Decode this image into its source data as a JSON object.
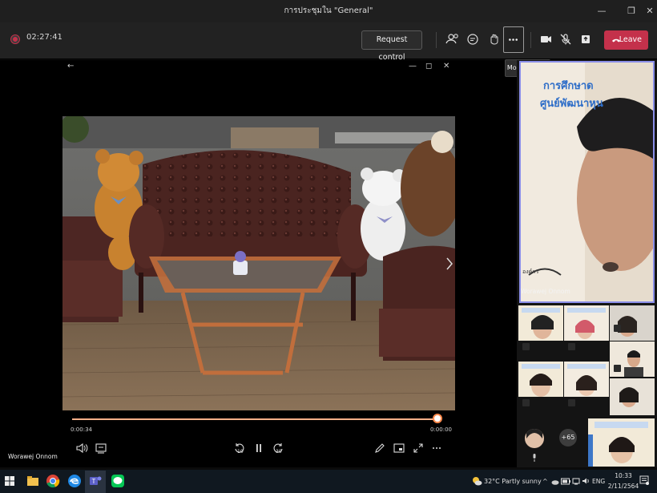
{
  "window": {
    "title": "การประชุมใน \"General\"",
    "minimize_glyph": "—",
    "maximize_glyph": "❐",
    "close_glyph": "✕"
  },
  "toolbar": {
    "timer": "02:27:41",
    "request_control_label": "Request control",
    "leave_label": "Leave",
    "more_actions_tooltip": "More actions",
    "icons": [
      "participants-icon",
      "chat-icon",
      "react-icon",
      "more-icon",
      "camera-icon",
      "mic-muted-icon",
      "share-icon"
    ]
  },
  "popout": {
    "back_glyph": "←",
    "minimize_glyph": "—",
    "maximize_glyph": "◻",
    "close_glyph": "✕"
  },
  "player": {
    "elapsed": "0:00:34",
    "remaining": "0:00:00",
    "progress": 1.0,
    "skip_back_label": "10",
    "skip_fwd_label": "30"
  },
  "presenter_name_bottom": "Worawej Onnom",
  "main_speaker": {
    "name": "Worawej Onnom",
    "slide_line1": "การศึกษาด",
    "slide_line2": "ศูนย์พัฒนาหุน",
    "slide_footer": "องค์กร"
  },
  "gallery": {
    "overflow_count": "+65"
  },
  "taskbar": {
    "weather": "32°C  Partly sunny",
    "lang": "ENG",
    "time": "10:33",
    "date": "2/11/2564"
  },
  "colors": {
    "accent": "#c4314b",
    "focus_border": "#8a8ee8",
    "progress": "#ff8a4c"
  }
}
